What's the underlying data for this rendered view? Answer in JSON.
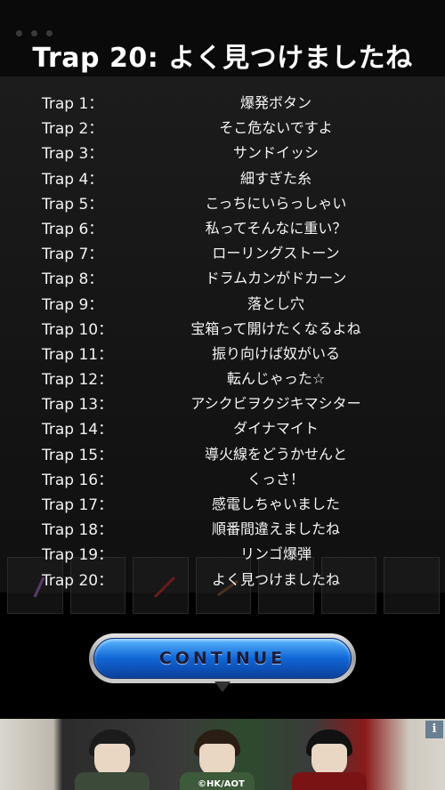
{
  "title": "Trap 20: よく見つけましたね",
  "traps": [
    {
      "label": "Trap 1：",
      "name": "爆発ボタン"
    },
    {
      "label": "Trap 2：",
      "name": "そこ危ないですよ"
    },
    {
      "label": "Trap 3：",
      "name": "サンドイッシ"
    },
    {
      "label": "Trap 4：",
      "name": "細すぎた糸"
    },
    {
      "label": "Trap 5：",
      "name": "こっちにいらっしゃい"
    },
    {
      "label": "Trap 6：",
      "name": "私ってそんなに重い？"
    },
    {
      "label": "Trap 7：",
      "name": "ローリングストーン"
    },
    {
      "label": "Trap 8：",
      "name": "ドラムカンがドカーン"
    },
    {
      "label": "Trap 9：",
      "name": "落とし穴"
    },
    {
      "label": "Trap 10：",
      "name": "宝箱って開けたくなるよね"
    },
    {
      "label": "Trap 11：",
      "name": "振り向けば奴がいる"
    },
    {
      "label": "Trap 12：",
      "name": "転んじゃった☆"
    },
    {
      "label": "Trap 13：",
      "name": "アシクビヲクジキマシター"
    },
    {
      "label": "Trap 14：",
      "name": "ダイナマイト"
    },
    {
      "label": "Trap 15：",
      "name": "導火線をどうかせんと"
    },
    {
      "label": "Trap 16：",
      "name": "くっさ！"
    },
    {
      "label": "Trap 17：",
      "name": "感電しちゃいました"
    },
    {
      "label": "Trap 18：",
      "name": "順番間違えましたね"
    },
    {
      "label": "Trap 19：",
      "name": "リンゴ爆弾"
    },
    {
      "label": "Trap 20：",
      "name": "よく見つけましたね"
    }
  ],
  "continue_label": "CONTINUE",
  "copyright": "©HK/AOT",
  "info_label": "i",
  "colors": {
    "button_blue": "#1166d6",
    "background": "#000000"
  }
}
